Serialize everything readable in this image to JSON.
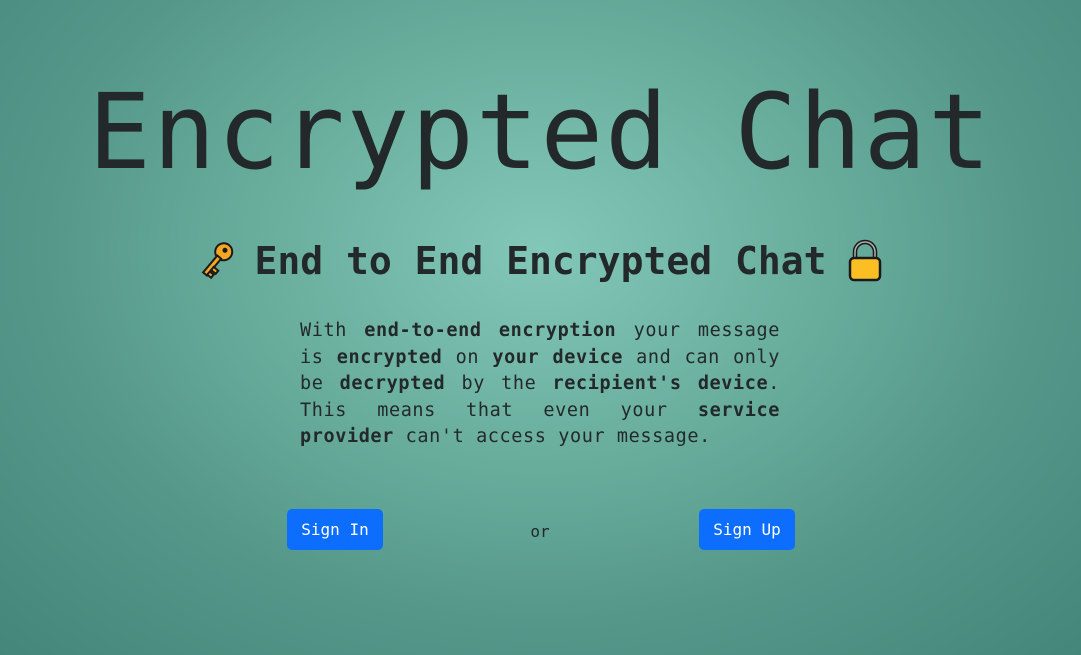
{
  "page": {
    "title": "Encrypted Chat",
    "subtitle": "End to End Encrypted Chat",
    "subtitle_icons": [
      "key-icon",
      "lock-icon"
    ],
    "description": [
      {
        "text": "With ",
        "bold": false
      },
      {
        "text": "end-to-end encryption",
        "bold": true
      },
      {
        "text": " your message is ",
        "bold": false
      },
      {
        "text": "encrypted",
        "bold": true
      },
      {
        "text": " on ",
        "bold": false
      },
      {
        "text": "your device",
        "bold": true
      },
      {
        "text": " and can only be ",
        "bold": false
      },
      {
        "text": "decrypted",
        "bold": true
      },
      {
        "text": " by the ",
        "bold": false
      },
      {
        "text": "recipient's device",
        "bold": true
      },
      {
        "text": ". This means that even your ",
        "bold": false
      },
      {
        "text": "service provider",
        "bold": true
      },
      {
        "text": " can't access your message.",
        "bold": false
      }
    ]
  },
  "actions": {
    "sign_in_label": "Sign In",
    "or_label": "or",
    "sign_up_label": "Sign Up"
  },
  "colors": {
    "button": "#0d6efd",
    "key": "#f5a623",
    "lock": "#fbbf24"
  }
}
